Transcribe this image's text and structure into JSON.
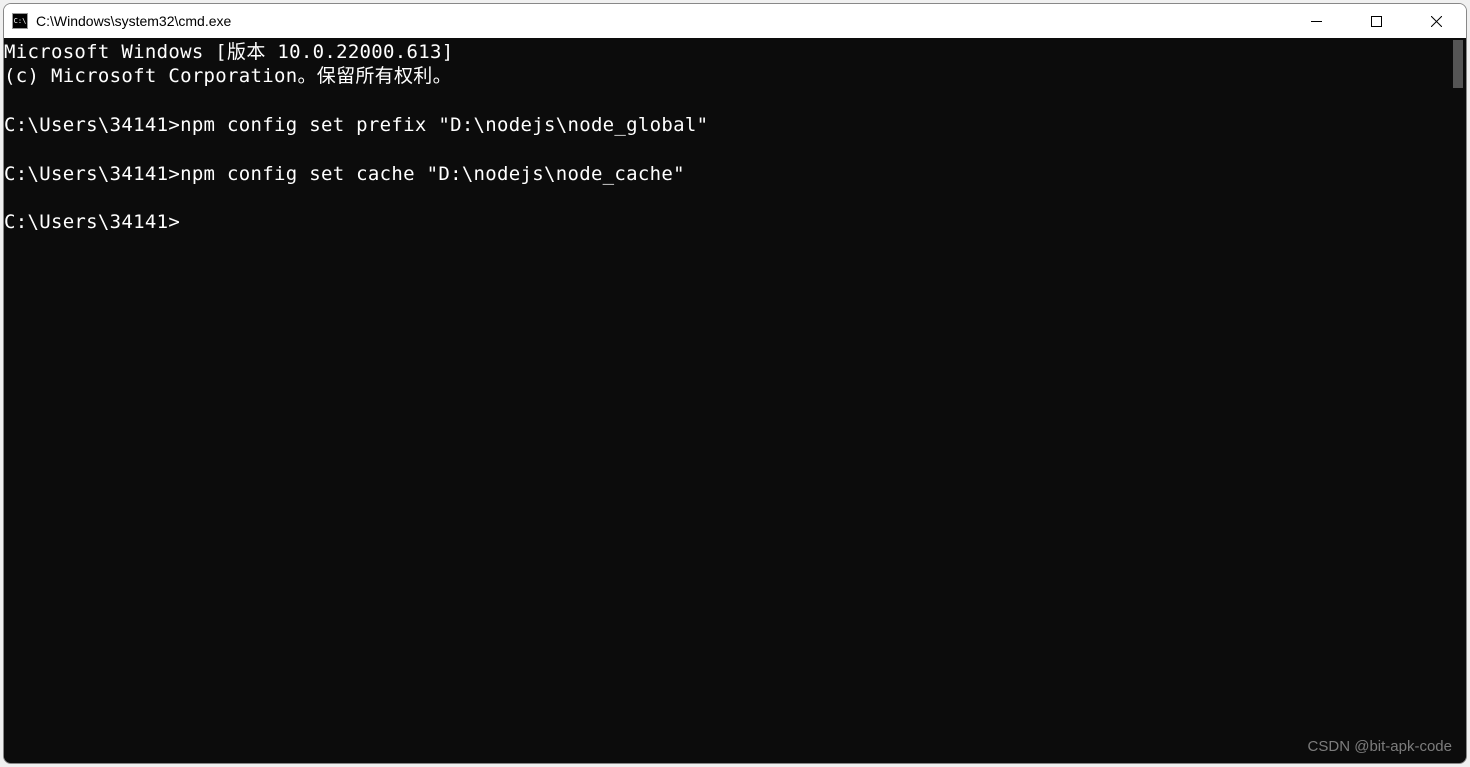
{
  "window": {
    "title": "C:\\Windows\\system32\\cmd.exe",
    "icon_text": "C:\\"
  },
  "terminal": {
    "lines": [
      "Microsoft Windows [版本 10.0.22000.613]",
      "(c) Microsoft Corporation。保留所有权利。",
      "",
      "C:\\Users\\34141>npm config set prefix \"D:\\nodejs\\node_global\"",
      "",
      "C:\\Users\\34141>npm config set cache \"D:\\nodejs\\node_cache\"",
      "",
      "C:\\Users\\34141>"
    ]
  },
  "watermark": "CSDN @bit-apk-code"
}
